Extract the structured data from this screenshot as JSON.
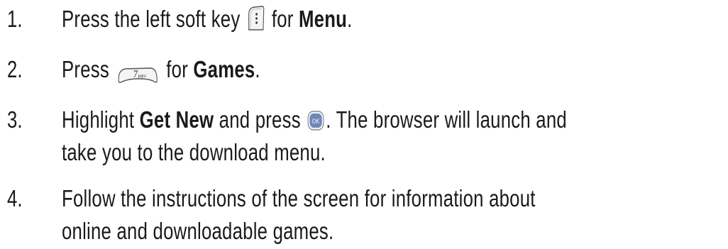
{
  "steps": [
    {
      "number": "1.",
      "before": "Press the left soft key",
      "icon": "left-softkey-icon",
      "middle": "for",
      "bold": "Menu",
      "after": "."
    },
    {
      "number": "2.",
      "before": "Press",
      "icon": "key-7-pqrs-icon",
      "icon_label_main": "7",
      "icon_label_sub": "pqrs",
      "middle": "for",
      "bold": "Games",
      "after": "."
    },
    {
      "number": "3.",
      "before": "Highlight",
      "bold": "Get New",
      "middle": "and press",
      "icon": "ok-key-icon",
      "icon_label": "OK",
      "after": ". The browser will launch and",
      "line2": "take you to the download menu."
    },
    {
      "number": "4.",
      "line1": "Follow the instructions of the screen for information about",
      "line2": "online and downloadable games."
    }
  ],
  "colors": {
    "text": "#1a1a1a",
    "ok_key_fill": "#6f86b8",
    "key_outline": "#555555"
  }
}
